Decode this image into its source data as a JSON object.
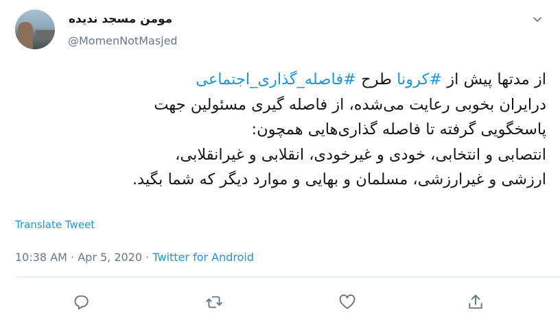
{
  "author": {
    "display_name": "مومن مسجد ندیده",
    "handle": "@MomenNotMasjed"
  },
  "tweet": {
    "lines": [
      [
        {
          "text": "از مدتها پیش از ",
          "hashtag": false
        },
        {
          "text": "#کرونا",
          "hashtag": true
        },
        {
          "text": " طرح ",
          "hashtag": false
        },
        {
          "text": "#فاصله_گذاری_اجتماعی",
          "hashtag": true
        }
      ],
      [
        {
          "text": "درایران بخوبی رعایت می‌شده، از فاصله گیری مسئولین جهت",
          "hashtag": false
        }
      ],
      [
        {
          "text": "پاسخگویی گرفته تا فاصله گذاری‌هایی همچون:",
          "hashtag": false
        }
      ],
      [
        {
          "text": "انتصابی و انتخابی، خودی و غیرخودی، انقلابی و غیرانقلابی،",
          "hashtag": false
        }
      ],
      [
        {
          "text": "ارزشی و غیرارزشی، مسلمان و بهایی و موارد دیگر که شما بگید.",
          "hashtag": false
        }
      ]
    ]
  },
  "translate_label": "Translate Tweet",
  "meta": {
    "time": "10:38 AM",
    "separator": "·",
    "date": "Apr 5, 2020",
    "source": "Twitter for Android"
  },
  "colors": {
    "link": "#1b95e0",
    "muted": "#657786",
    "text": "#14171a"
  },
  "icons": {
    "menu": "chevron-down-icon",
    "reply": "reply-icon",
    "retweet": "retweet-icon",
    "like": "like-icon",
    "share": "share-icon"
  }
}
